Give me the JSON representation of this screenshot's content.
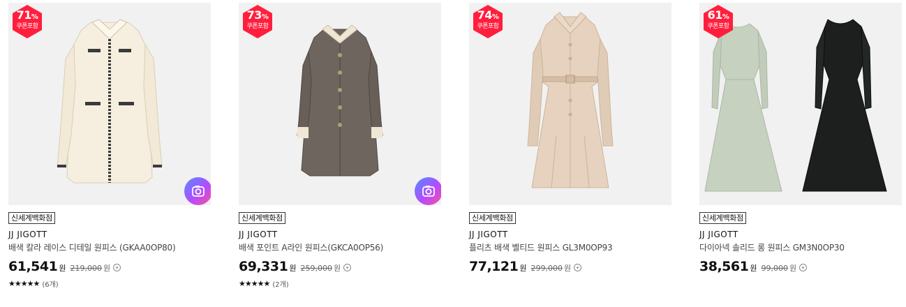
{
  "products": [
    {
      "discount": "71",
      "discount_unit": "%",
      "coupon": "쿠폰포함",
      "store": "신세계백화점",
      "brand": "JJ JIGOTT",
      "name": "배색 칼라 레이스 디테일 원피스 (GKAA0OP80)",
      "price": "61,541",
      "price_unit": "원",
      "original_price": "219,000",
      "original_unit": "원",
      "stars": "★★★★★",
      "review_count": "(6개)",
      "rating": 5,
      "has_camera": true,
      "image": "cream tweed coat dress"
    },
    {
      "discount": "73",
      "discount_unit": "%",
      "coupon": "쿠폰포함",
      "store": "신세계백화점",
      "brand": "JJ JIGOTT",
      "name": "배색 포인트 A라인 원피스(GKCA0OP56)",
      "price": "69,331",
      "price_unit": "원",
      "original_price": "259,000",
      "original_unit": "원",
      "stars": "★★★★★",
      "review_count": "(2개)",
      "rating": 4.5,
      "has_camera": true,
      "image": "brown herringbone coat dress"
    },
    {
      "discount": "74",
      "discount_unit": "%",
      "coupon": "쿠폰포함",
      "store": "신세계백화점",
      "brand": "JJ JIGOTT",
      "name": "플리츠 배색 벨티드 원피스 GL3M0OP93",
      "price": "77,121",
      "price_unit": "원",
      "original_price": "299,000",
      "original_unit": "원",
      "has_camera": false,
      "image": "beige belted pleated dress"
    },
    {
      "discount": "61",
      "discount_unit": "%",
      "coupon": "쿠폰포함",
      "store": "신세계백화점",
      "brand": "JJ JIGOTT",
      "name": "다이아넥 솔리드 롱 원피스 GM3N0OP30",
      "price": "38,561",
      "price_unit": "원",
      "original_price": "99,000",
      "original_unit": "원",
      "has_camera": false,
      "image": "mint and black long dresses"
    }
  ],
  "colors": {
    "badge": "#ff1f3d",
    "cream": "#f6efdf",
    "brown": "#6e655e",
    "beige": "#e6d2bf",
    "mint": "#c6d1c0",
    "black": "#1c1f1d"
  },
  "icons": {
    "camera": "camera-icon",
    "info": "info-circle-icon",
    "badge": "discount-badge-icon"
  }
}
